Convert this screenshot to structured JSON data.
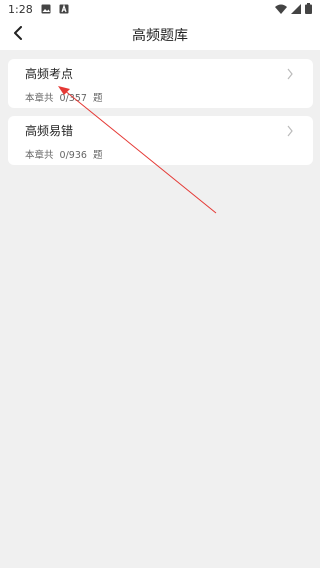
{
  "status_bar": {
    "time": "1:28",
    "icons": [
      "image-icon",
      "a-badge-icon",
      "wifi-icon",
      "signal-icon",
      "battery-icon"
    ]
  },
  "nav": {
    "back_icon": "chevron-left-icon",
    "title": "高频题库"
  },
  "cards": [
    {
      "title": "高频考点",
      "prefix": "本章共",
      "progress": "0/357",
      "suffix": "题"
    },
    {
      "title": "高频易错",
      "prefix": "本章共",
      "progress": "0/936",
      "suffix": "题"
    }
  ],
  "annotation": {
    "color": "#e53935"
  }
}
